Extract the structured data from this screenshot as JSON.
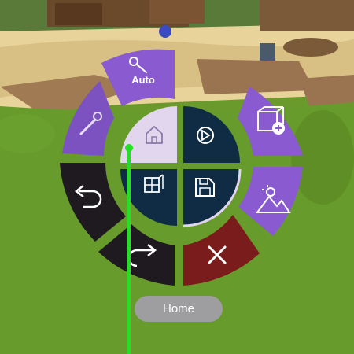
{
  "menu": {
    "auto_label": "Auto",
    "tooltip": "Home",
    "items": [
      {
        "name": "auto",
        "icon": "wand-icon"
      },
      {
        "name": "settings",
        "icon": "wrench-icon"
      },
      {
        "name": "add-object",
        "icon": "cube-plus-icon"
      },
      {
        "name": "undo",
        "icon": "undo-icon"
      },
      {
        "name": "environment",
        "icon": "landscape-icon"
      },
      {
        "name": "redo",
        "icon": "redo-icon"
      },
      {
        "name": "close",
        "icon": "close-icon"
      },
      {
        "name": "home",
        "icon": "home-icon"
      },
      {
        "name": "play",
        "icon": "play-icon"
      },
      {
        "name": "layers",
        "icon": "layers-icon"
      },
      {
        "name": "save",
        "icon": "save-icon"
      }
    ]
  },
  "colors": {
    "purple": "#8a5ad0",
    "purple_dark": "#6a42b0",
    "navy": "#102c44",
    "black": "#1e1a20",
    "red": "#7a1c1c",
    "home_highlight": "#e2d6ee",
    "pointer": "#22e022",
    "pill": "#9e9ea0"
  }
}
